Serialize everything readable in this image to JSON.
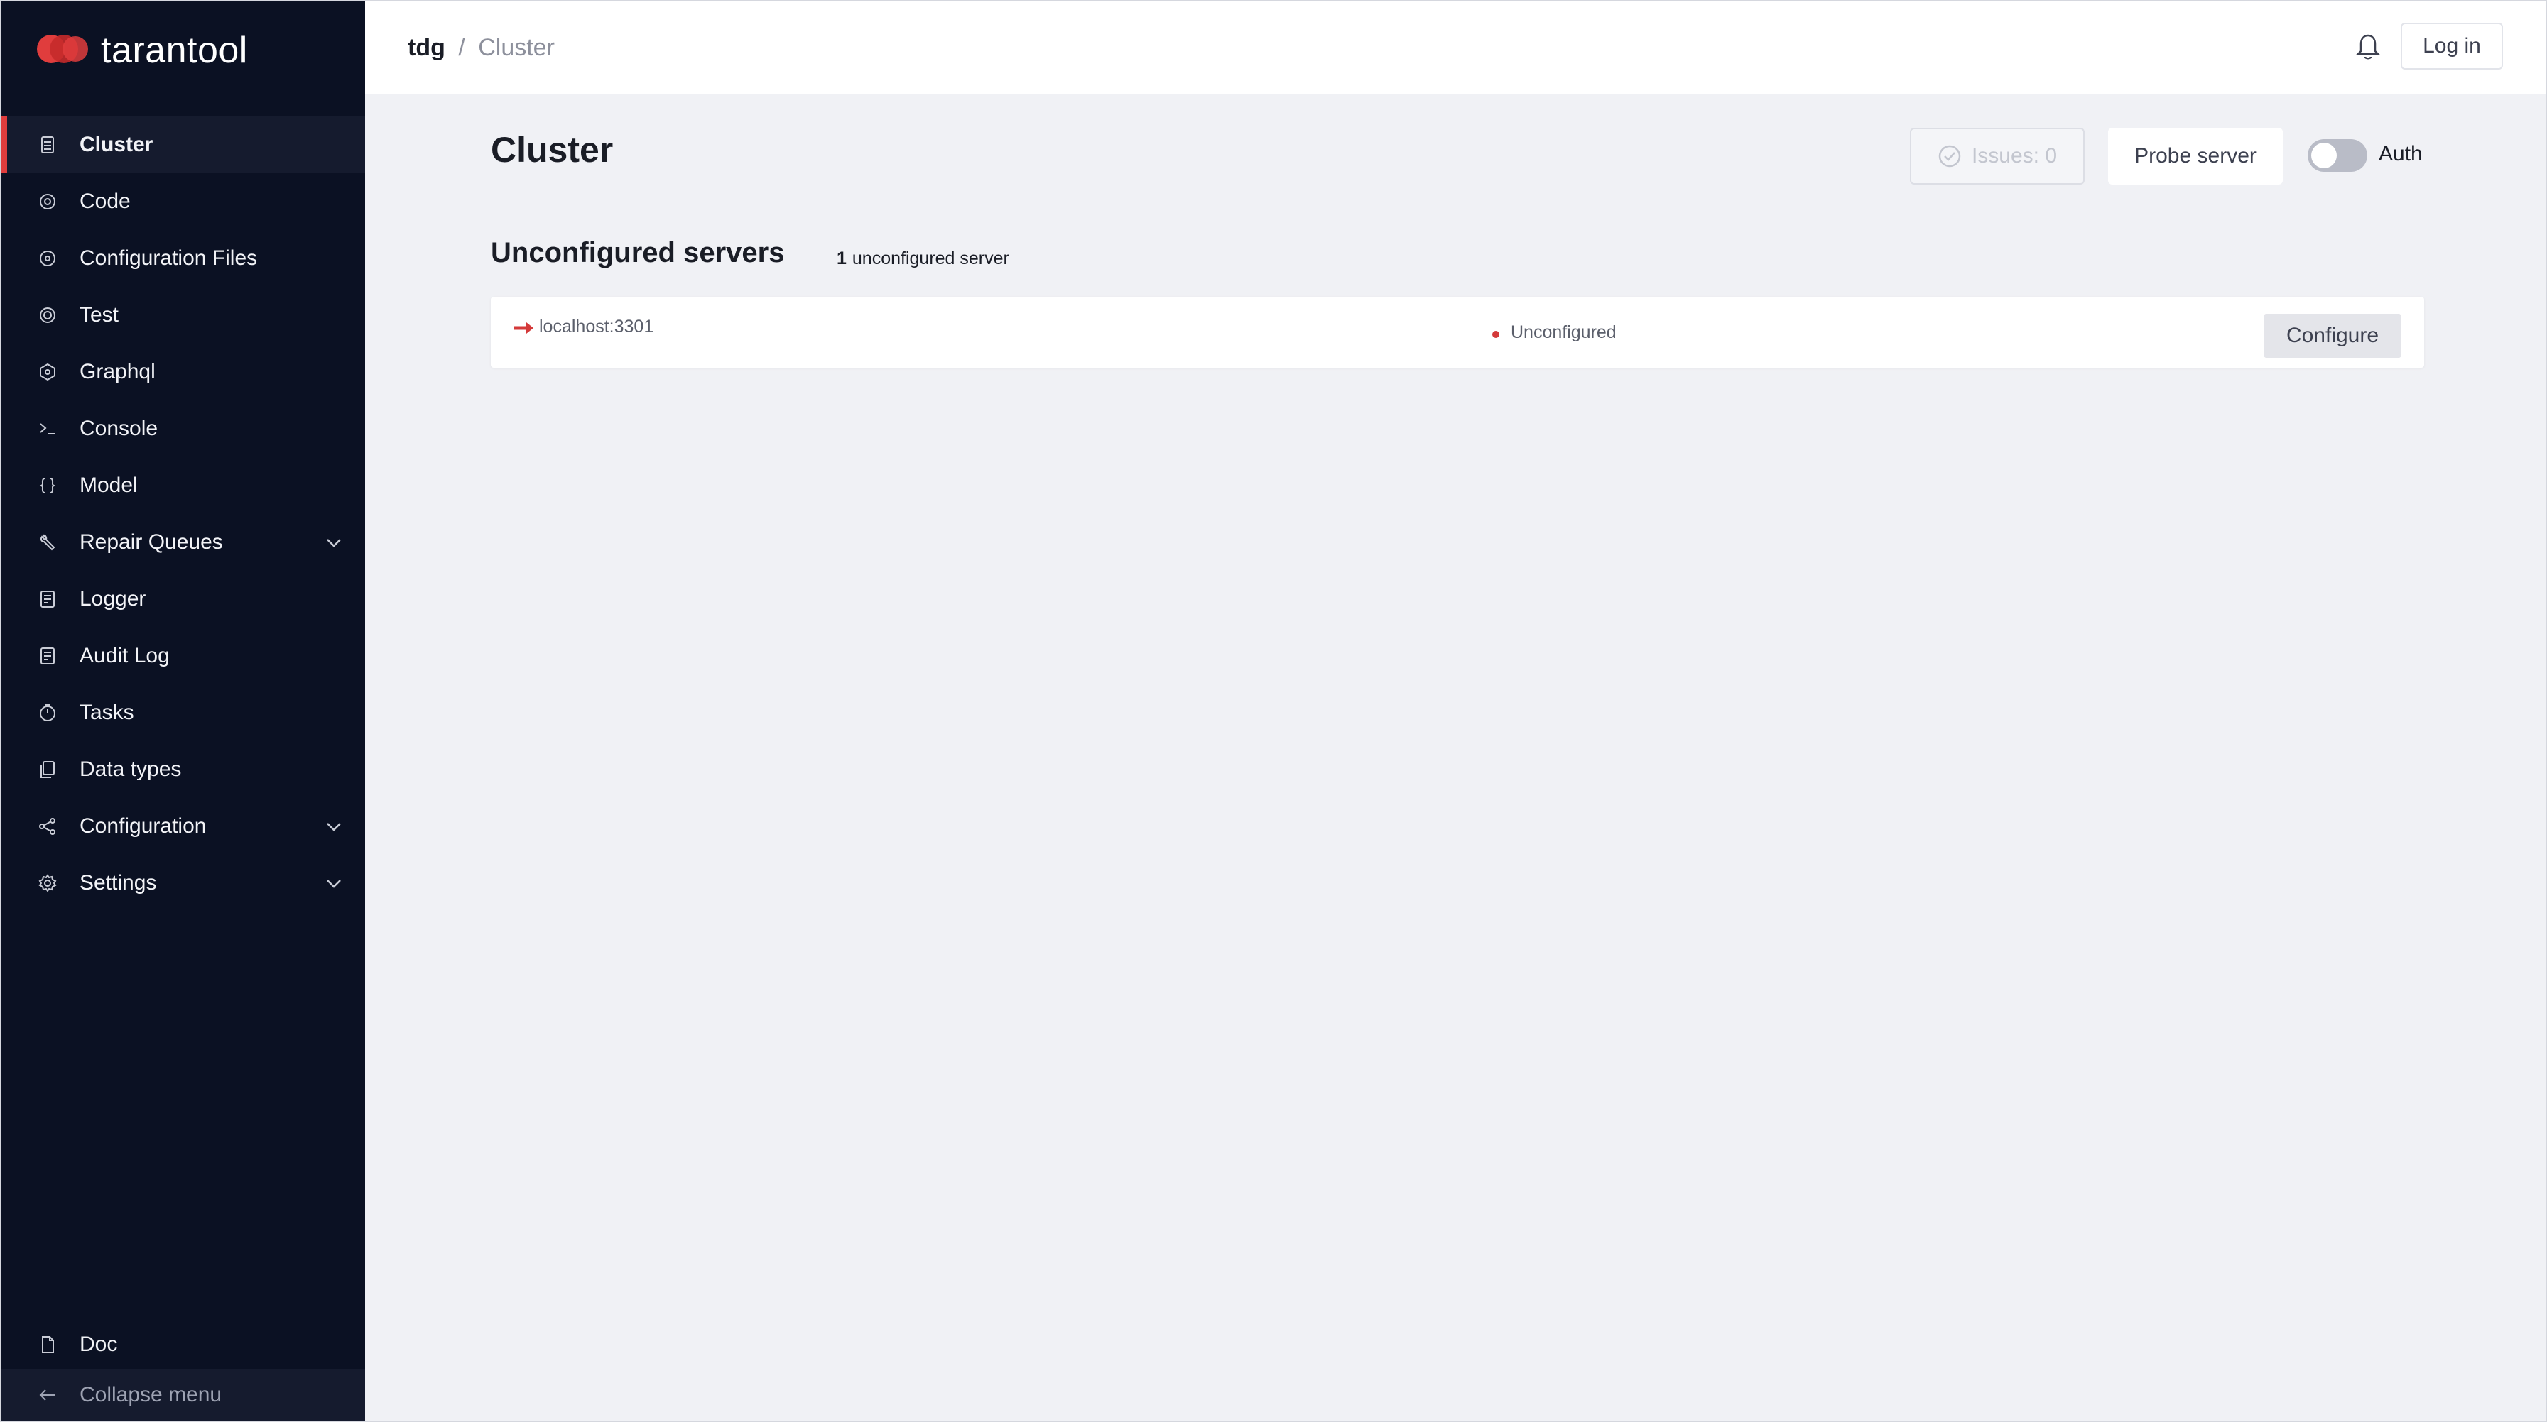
{
  "brand": {
    "name": "tarantool",
    "logo_icon": "tarantool-logo-icon",
    "logo_color": "#e03d3d"
  },
  "sidebar": {
    "items": [
      {
        "label": "Cluster",
        "icon": "server-icon",
        "active": true
      },
      {
        "label": "Code",
        "icon": "code-icon"
      },
      {
        "label": "Configuration Files",
        "icon": "config-files-icon"
      },
      {
        "label": "Test",
        "icon": "test-icon"
      },
      {
        "label": "Graphql",
        "icon": "graphql-icon"
      },
      {
        "label": "Console",
        "icon": "console-icon"
      },
      {
        "label": "Model",
        "icon": "braces-icon"
      },
      {
        "label": "Repair Queues",
        "icon": "wrench-icon",
        "expandable": true
      },
      {
        "label": "Logger",
        "icon": "log-icon"
      },
      {
        "label": "Audit Log",
        "icon": "log-icon"
      },
      {
        "label": "Tasks",
        "icon": "timer-icon"
      },
      {
        "label": "Data types",
        "icon": "data-types-icon"
      },
      {
        "label": "Configuration",
        "icon": "share-icon",
        "expandable": true
      },
      {
        "label": "Settings",
        "icon": "gear-icon",
        "expandable": true
      }
    ],
    "doc_label": "Doc",
    "collapse_label": "Collapse menu"
  },
  "topbar": {
    "breadcrumb_root": "tdg",
    "breadcrumb_separator": "/",
    "breadcrumb_current": "Cluster",
    "login_label": "Log in"
  },
  "main": {
    "title": "Cluster",
    "issues_label": "Issues: 0",
    "probe_label": "Probe server",
    "auth_label": "Auth",
    "auth_enabled": false,
    "section_title": "Unconfigured servers",
    "section_count_number": "1",
    "section_count_text": "unconfigured server",
    "servers": [
      {
        "uri": "localhost:3301",
        "status": "Unconfigured",
        "action": "Configure",
        "status_color": "#d43a3a"
      }
    ]
  },
  "colors": {
    "sidebar_bg": "#0b1123",
    "accent": "#e03d3d",
    "page_bg": "#f0f1f5"
  }
}
